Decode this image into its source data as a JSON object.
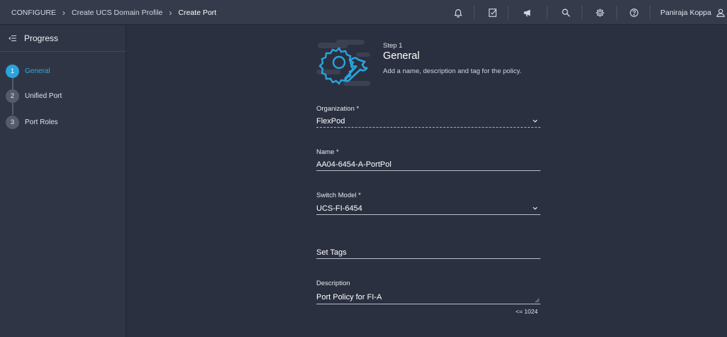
{
  "breadcrumb": {
    "items": [
      "CONFIGURE",
      "Create UCS Domain Profile",
      "Create Port"
    ]
  },
  "header": {
    "icons": [
      "bell-icon",
      "task-check-icon",
      "announcement-icon",
      "search-icon",
      "gear-icon",
      "help-icon"
    ],
    "user_name": "Paniraja Koppa"
  },
  "sidebar": {
    "title": "Progress",
    "steps": [
      {
        "number": "1",
        "label": "General",
        "active": true
      },
      {
        "number": "2",
        "label": "Unified Port",
        "active": false
      },
      {
        "number": "3",
        "label": "Port Roles",
        "active": false
      }
    ]
  },
  "main": {
    "step_number": "Step 1",
    "step_title": "General",
    "step_description": "Add a name, description and tag for the policy.",
    "fields": {
      "organization": {
        "label": "Organization *",
        "value": "FlexPod"
      },
      "name": {
        "label": "Name *",
        "value": "AA04-6454-A-PortPol"
      },
      "switch_model": {
        "label": "Switch Model *",
        "value": "UCS-FI-6454"
      },
      "tags": {
        "placeholder": "Set Tags"
      },
      "description": {
        "label": "Description",
        "value": "Port Policy for FI-A",
        "limit": "<= 1024"
      }
    }
  },
  "colors": {
    "accent": "#2aa3dd",
    "background": "#2b3040",
    "topbar": "#363b4c",
    "sidebar": "#303546"
  }
}
